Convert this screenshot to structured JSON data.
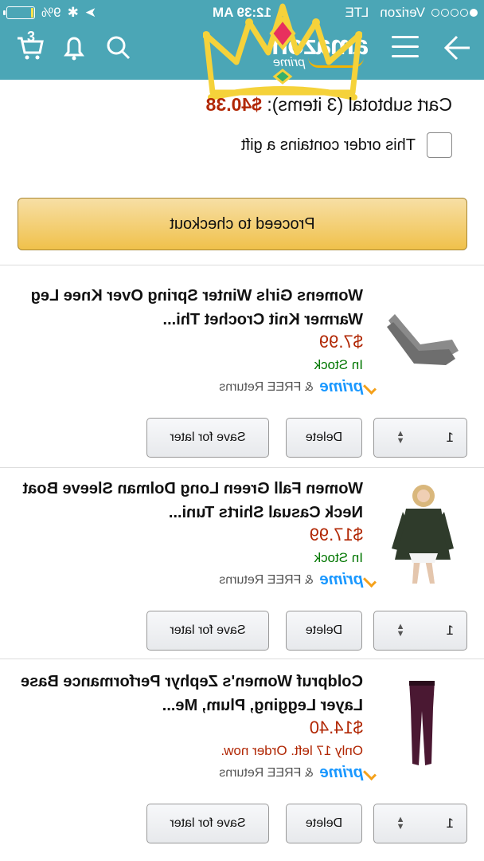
{
  "status": {
    "carrier": "Verizon",
    "network": "LTE",
    "time": "12:39 AM",
    "battery": "9%",
    "battery_level": 0.09
  },
  "header": {
    "logo_word": "amazon",
    "logo_sub": "prime",
    "cart_count": "3",
    "icons": [
      "back-arrow-icon",
      "menu-icon",
      "search-icon",
      "bell-icon",
      "cart-icon"
    ],
    "bg_color": "#4ba6b6"
  },
  "cart": {
    "subtotal_label": "Cart subtotal (3 items):",
    "subtotal_amount": "$40.38",
    "gift_label": "This order contains a gift",
    "checkout_label": "Proceed to checkout"
  },
  "items": [
    {
      "title": "Womens Girls Winter Spring Over Knee Leg Warmer Knit Crochet Thi...",
      "price": "$7.99",
      "stock": "In Stock",
      "prime": "prime",
      "returns": "& FREE Returns",
      "qty": "1",
      "delete_label": "Delete",
      "save_label": "Save for later",
      "image": "leg-warmers-image"
    },
    {
      "title": "Women Fall Green Long Dolman Sleeve Boat Neck Casual Shirts Tuni...",
      "price": "$17.99",
      "stock": "In Stock",
      "prime": "prime",
      "returns": "& FREE Returns",
      "qty": "1",
      "delete_label": "Delete",
      "save_label": "Save for later",
      "image": "green-sweater-image"
    },
    {
      "title": "Coldpruf Women's Zephyr Performance Base Layer Legging, Plum, Me...",
      "price": "$14.40",
      "stock": "Only 17 left. Order now.",
      "prime": "prime",
      "returns": "& FREE Returns",
      "qty": "1",
      "delete_label": "Delete",
      "save_label": "Save for later",
      "image": "plum-leggings-image"
    }
  ]
}
